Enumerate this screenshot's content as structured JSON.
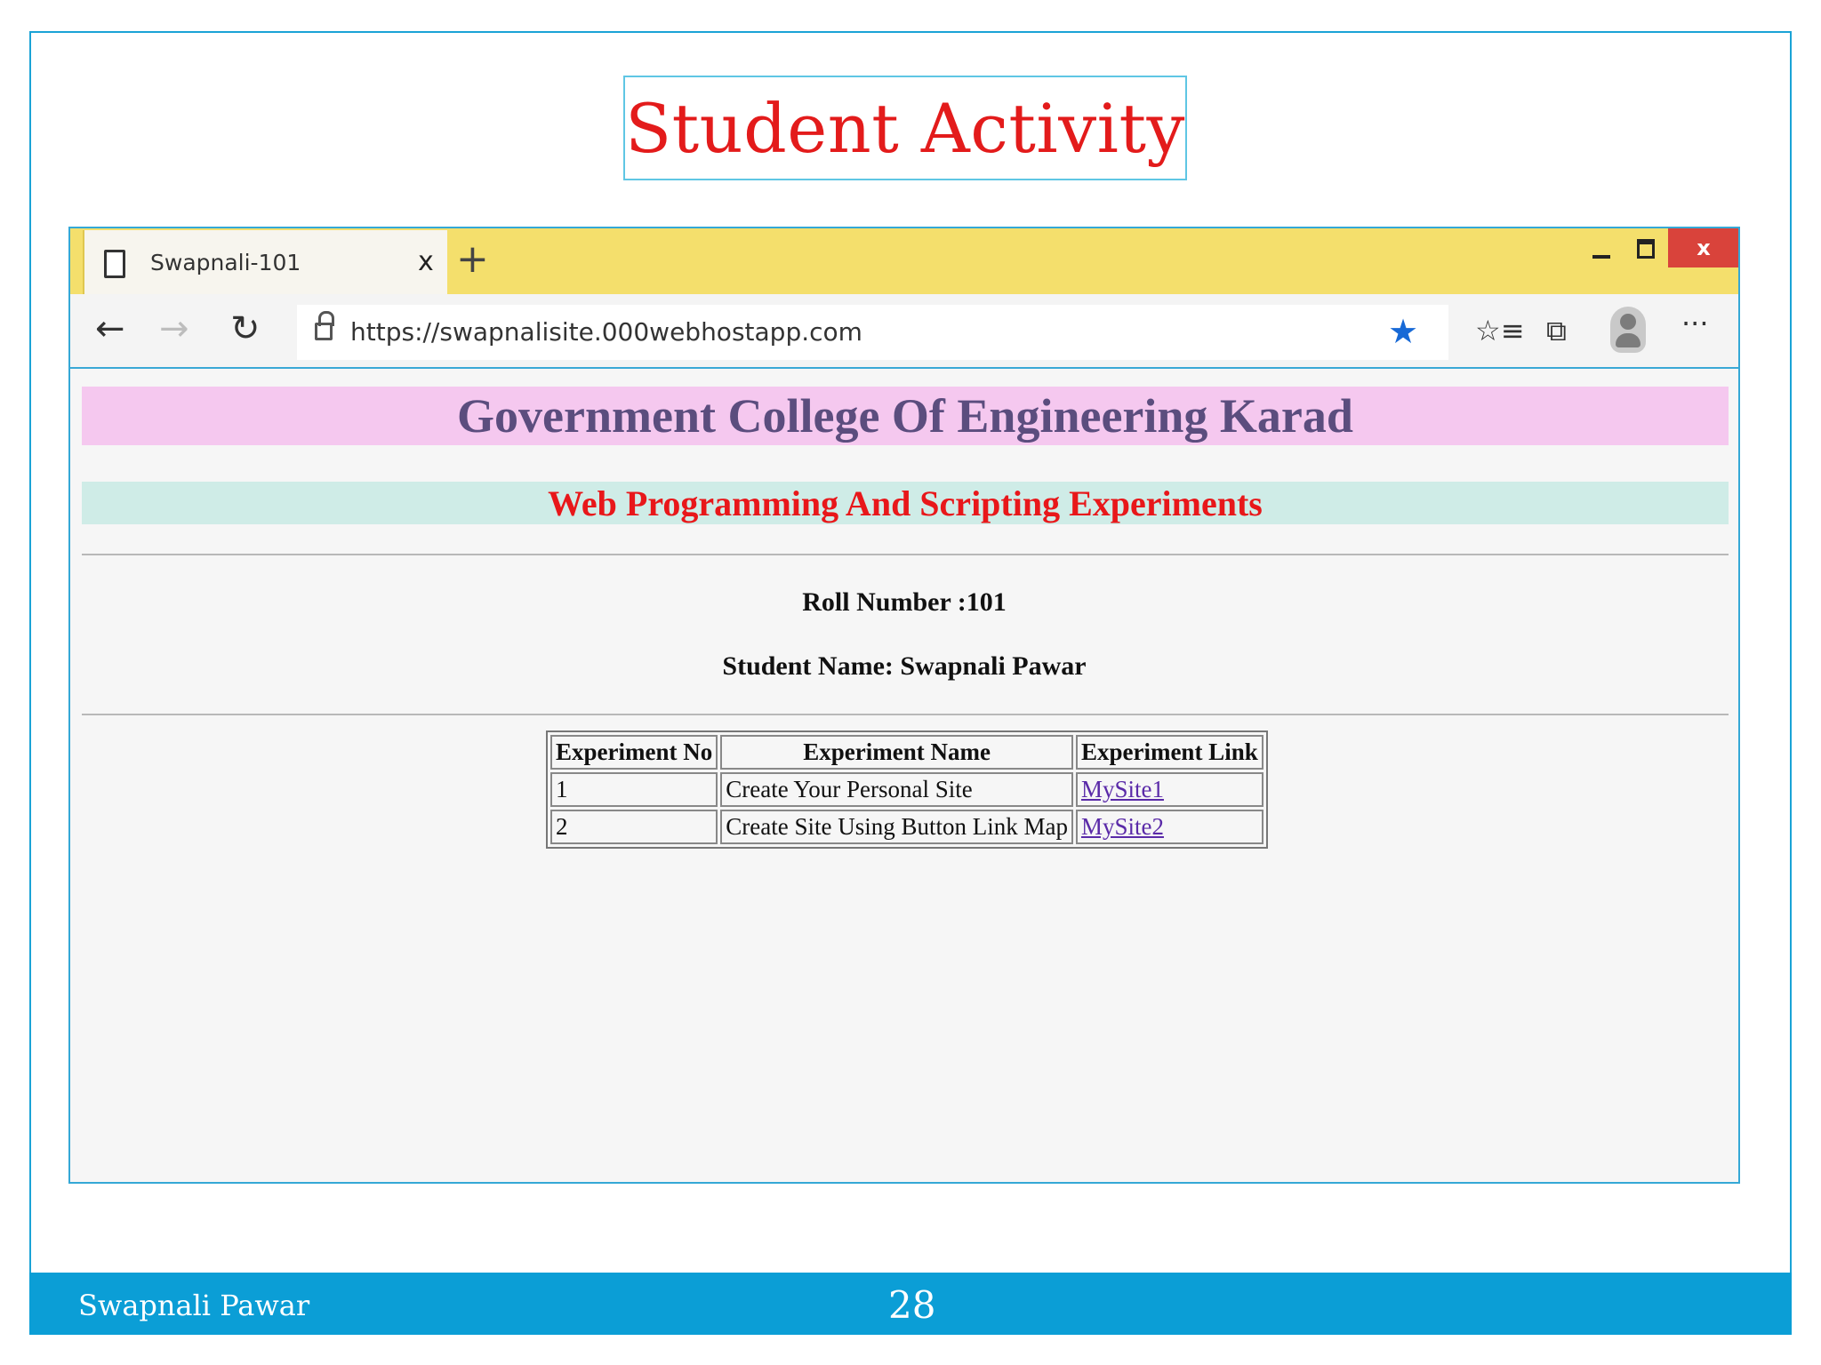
{
  "slide": {
    "title": "Student Activity",
    "footer_author": "Swapnali Pawar",
    "page_number": "28"
  },
  "browser": {
    "tab_title": "Swapnali-101",
    "tab_close": "x",
    "new_tab": "+",
    "window_close": "x",
    "url": "https://swapnalisite.000webhostapp.com"
  },
  "page": {
    "college_name": "Government College Of Engineering Karad",
    "course_title": "Web Programming And Scripting Experiments",
    "roll_number": "Roll Number :101",
    "student_name": "Student Name: Swapnali Pawar",
    "table": {
      "headers": [
        "Experiment No",
        "Experiment Name",
        "Experiment Link"
      ],
      "rows": [
        {
          "no": "1",
          "name": "Create Your Personal Site",
          "link": "MySite1"
        },
        {
          "no": "2",
          "name": "Create Site Using Button Link Map",
          "link": "MySite2"
        }
      ]
    }
  },
  "colors": {
    "title_red": "#e31b1b",
    "tabbar_yellow": "#f4df6c",
    "banner_pink": "#f5c8ef",
    "banner_mint": "#cfece7",
    "footer_blue": "#0b9ed6"
  }
}
